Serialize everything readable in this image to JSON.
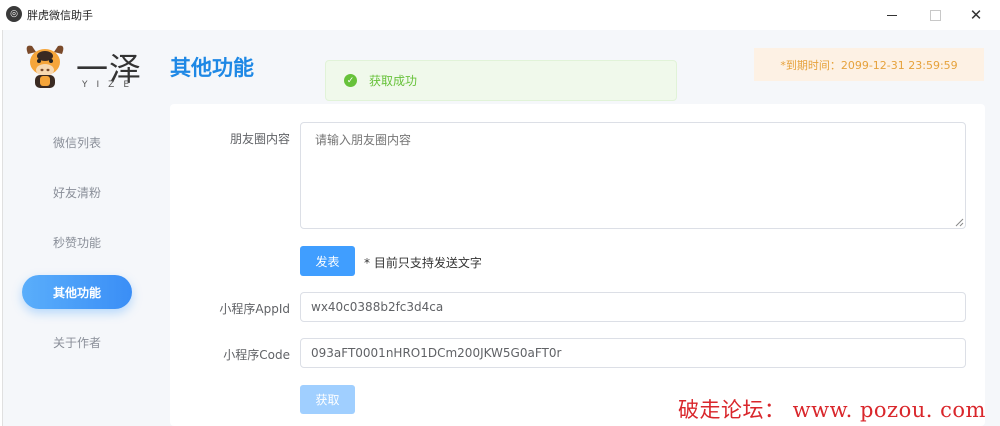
{
  "window": {
    "title": "胖虎微信助手",
    "icon": "app-logo-icon"
  },
  "brand": {
    "name": "一泽",
    "subtitle": "YIZE",
    "logo_icon": "cow-icon"
  },
  "header": {
    "title": "其他功能",
    "expiry": "*到期时间：2099-12-31 23:59:59"
  },
  "toast": {
    "message": "获取成功",
    "icon": "check-circle-icon",
    "color": "#67c23a"
  },
  "sidebar": {
    "items": [
      {
        "label": "微信列表",
        "active": false
      },
      {
        "label": "好友清粉",
        "active": false
      },
      {
        "label": "秒赞功能",
        "active": false
      },
      {
        "label": "其他功能",
        "active": true
      },
      {
        "label": "关于作者",
        "active": false
      }
    ]
  },
  "form": {
    "moments_label": "朋友圈内容",
    "moments_placeholder": "请输入朋友圈内容",
    "moments_value": "",
    "publish_button": "发表",
    "publish_note": "* 目前只支持发送文字",
    "appid_label": "小程序AppId",
    "appid_value": "wx40c0388b2fc3d4ca",
    "code_label": "小程序Code",
    "code_value": "093aFT0001nHRO1DCm200JKW5G0aFT0r",
    "fetch_button": "获取"
  },
  "watermark": "破走论坛： www. pozou. com",
  "colors": {
    "accent": "#409eff",
    "heading": "#1e88e5",
    "warning": "#e6a23c",
    "watermark": "#d9262b"
  }
}
